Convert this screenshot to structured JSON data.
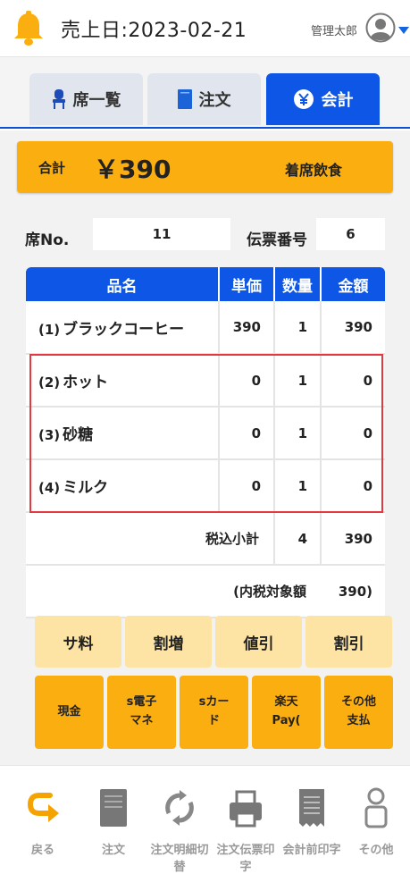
{
  "header": {
    "sales_date": "売上日:2023-02-21",
    "user_name": "管理太郎"
  },
  "tabs": [
    {
      "label": "席一覧",
      "icon": "chair-icon",
      "active": false
    },
    {
      "label": "注文",
      "icon": "notebook-icon",
      "active": false
    },
    {
      "label": "会計",
      "icon": "yen-coin-icon",
      "active": true
    }
  ],
  "total": {
    "label": "合計",
    "amount": "￥390",
    "type": "着席飲食"
  },
  "seat": {
    "label": "席No.",
    "value": "11"
  },
  "slip": {
    "label": "伝票番号",
    "value": "6"
  },
  "table": {
    "headers": [
      "品名",
      "単価",
      "数量",
      "金額"
    ],
    "rows": [
      {
        "num": "(1)",
        "name": "ブラックコーヒー",
        "price": "390",
        "qty": "1",
        "amount": "390"
      },
      {
        "num": "(2)",
        "name": "ホット",
        "price": "0",
        "qty": "1",
        "amount": "0"
      },
      {
        "num": "(3)",
        "name": "砂糖",
        "price": "0",
        "qty": "1",
        "amount": "0"
      },
      {
        "num": "(4)",
        "name": "ミルク",
        "price": "0",
        "qty": "1",
        "amount": "0"
      }
    ],
    "subtotal": {
      "label": "税込小計",
      "qty": "4",
      "amount": "390"
    },
    "tax_base": {
      "label": "(内税対象額",
      "amount": "390)"
    }
  },
  "adjust_buttons": [
    "サ料",
    "割増",
    "値引",
    "割引"
  ],
  "pay_buttons": [
    "現金",
    "s電子\nマネ",
    "sカー\nド",
    "楽天\nPay(",
    "その他\n支払"
  ],
  "footer": [
    {
      "label": "戻る",
      "icon": "return-arrow-icon"
    },
    {
      "label": "注文",
      "icon": "notebook-icon"
    },
    {
      "label": "注文明細切\n替",
      "icon": "refresh-icon"
    },
    {
      "label": "注文伝票印\n字",
      "icon": "printer-icon"
    },
    {
      "label": "会計前印字",
      "icon": "receipt-icon"
    },
    {
      "label": "その他",
      "icon": "person-icon"
    }
  ],
  "colors": {
    "accent_blue": "#0d56e6",
    "accent_orange": "#fbae10",
    "light_orange": "#fde4a4",
    "highlight_red": "#e4393f"
  }
}
